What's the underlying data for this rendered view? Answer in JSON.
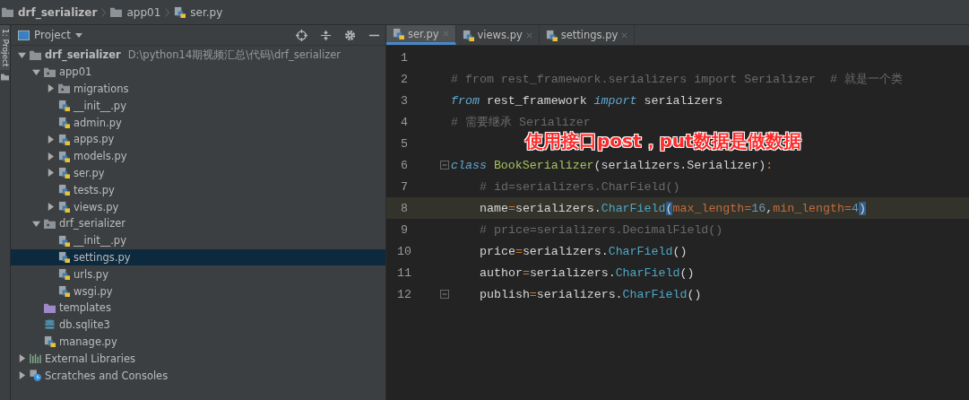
{
  "breadcrumbs": [
    {
      "label": "drf_serializer",
      "kind": "folder"
    },
    {
      "label": "app01",
      "kind": "folder"
    },
    {
      "label": "ser.py",
      "kind": "py"
    }
  ],
  "side_strip": {
    "label": "1: Project"
  },
  "project_panel": {
    "title": "Project",
    "tree": [
      {
        "label": "drf_serializer",
        "path": "D:\\python14期视频汇总\\代码\\drf_serializer",
        "kind": "folder",
        "expanded": true,
        "selected": false,
        "children": [
          {
            "label": "app01",
            "kind": "package",
            "expanded": true,
            "selected": false,
            "children": [
              {
                "label": "migrations",
                "kind": "package",
                "expanded": false,
                "selected": false
              },
              {
                "label": "__init__.py",
                "kind": "py",
                "selected": false
              },
              {
                "label": "admin.py",
                "kind": "py",
                "selected": false
              },
              {
                "label": "apps.py",
                "kind": "py",
                "expanded": false,
                "selected": false
              },
              {
                "label": "models.py",
                "kind": "py",
                "expanded": false,
                "selected": false
              },
              {
                "label": "ser.py",
                "kind": "py",
                "expanded": false,
                "selected": false
              },
              {
                "label": "tests.py",
                "kind": "py",
                "selected": false
              },
              {
                "label": "views.py",
                "kind": "py",
                "expanded": false,
                "selected": false
              }
            ]
          },
          {
            "label": "drf_serializer",
            "kind": "package",
            "expanded": true,
            "selected": false,
            "children": [
              {
                "label": "__init__.py",
                "kind": "py",
                "selected": false
              },
              {
                "label": "settings.py",
                "kind": "py",
                "selected": true
              },
              {
                "label": "urls.py",
                "kind": "py",
                "selected": false
              },
              {
                "label": "wsgi.py",
                "kind": "py",
                "selected": false
              }
            ]
          },
          {
            "label": "templates",
            "kind": "templates",
            "selected": false
          },
          {
            "label": "db.sqlite3",
            "kind": "db",
            "selected": false
          },
          {
            "label": "manage.py",
            "kind": "py",
            "selected": false
          }
        ]
      },
      {
        "label": "External Libraries",
        "kind": "libraries",
        "expanded": false,
        "selected": false
      },
      {
        "label": "Scratches and Consoles",
        "kind": "scratches",
        "expanded": false,
        "selected": false
      }
    ]
  },
  "tabs": [
    {
      "label": "ser.py",
      "selected": true
    },
    {
      "label": "views.py",
      "selected": false
    },
    {
      "label": "settings.py",
      "selected": false
    }
  ],
  "editor": {
    "lines": [
      {
        "number": "1",
        "current": false
      },
      {
        "number": "2",
        "current": false,
        "indented": false,
        "tokens": [
          {
            "kind": "comment",
            "text": "# from rest_framework.serializers import Serializer  # 就是一个类"
          }
        ]
      },
      {
        "number": "3",
        "current": false,
        "indented": false,
        "tokens": [
          {
            "kind": "keyword",
            "text": "from"
          },
          {
            "kind": "plain",
            "text": " rest_framework "
          },
          {
            "kind": "keyword",
            "text": "import"
          },
          {
            "kind": "plain",
            "text": " serializers"
          }
        ]
      },
      {
        "number": "4",
        "current": false,
        "indented": false,
        "tokens": [
          {
            "kind": "comment",
            "text": "# 需要继承 Serializer"
          }
        ]
      },
      {
        "number": "5",
        "current": false
      },
      {
        "number": "6",
        "current": false,
        "fold": true,
        "indented": false,
        "tokens": [
          {
            "kind": "keyword",
            "text": "class"
          },
          {
            "kind": "classname",
            "text": " BookSerializer"
          },
          {
            "kind": "plain",
            "text": "(serializers.Serializer)"
          },
          {
            "kind": "operator",
            "text": ":"
          }
        ]
      },
      {
        "number": "7",
        "current": false,
        "indented": true,
        "tokens": [
          {
            "kind": "comment",
            "text": "# id=serializers.CharField()"
          }
        ]
      },
      {
        "number": "8",
        "current": true,
        "indented": true,
        "tokens": [
          {
            "kind": "plain",
            "text": "name"
          },
          {
            "kind": "operator",
            "text": "="
          },
          {
            "kind": "plain",
            "text": "serializers."
          },
          {
            "kind": "call",
            "text": "CharField"
          },
          {
            "kind": "match",
            "text": "("
          },
          {
            "kind": "param",
            "text": "max_length="
          },
          {
            "kind": "number",
            "text": "16"
          },
          {
            "kind": "plain",
            "text": ","
          },
          {
            "kind": "param",
            "text": "min_length="
          },
          {
            "kind": "number",
            "text": "4"
          },
          {
            "kind": "match",
            "text": ")"
          }
        ]
      },
      {
        "number": "9",
        "current": false,
        "indented": true,
        "tokens": [
          {
            "kind": "comment",
            "text": "# price=serializers.DecimalField()"
          }
        ]
      },
      {
        "number": "10",
        "current": false,
        "indented": true,
        "tokens": [
          {
            "kind": "plain",
            "text": "price"
          },
          {
            "kind": "operator",
            "text": "="
          },
          {
            "kind": "plain",
            "text": "serializers."
          },
          {
            "kind": "call",
            "text": "CharField"
          },
          {
            "kind": "plain",
            "text": "()"
          }
        ]
      },
      {
        "number": "11",
        "current": false,
        "indented": true,
        "tokens": [
          {
            "kind": "plain",
            "text": "author"
          },
          {
            "kind": "operator",
            "text": "="
          },
          {
            "kind": "plain",
            "text": "serializers."
          },
          {
            "kind": "call",
            "text": "CharField"
          },
          {
            "kind": "plain",
            "text": "()"
          }
        ]
      },
      {
        "number": "12",
        "current": false,
        "fold": true,
        "indented": true,
        "tokens": [
          {
            "kind": "plain",
            "text": "publish"
          },
          {
            "kind": "operator",
            "text": "="
          },
          {
            "kind": "plain",
            "text": "serializers."
          },
          {
            "kind": "call",
            "text": "CharField"
          },
          {
            "kind": "plain",
            "text": "()"
          }
        ]
      }
    ]
  },
  "annotation": {
    "text": "使用接口post，put数据是做数据"
  }
}
